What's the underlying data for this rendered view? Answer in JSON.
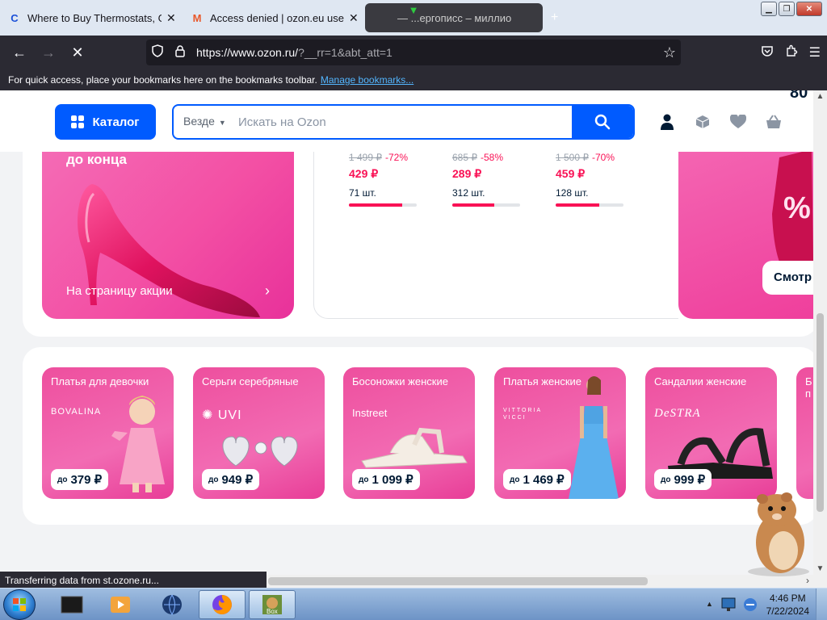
{
  "browser": {
    "tabs": [
      {
        "title": "Where to Buy Thermostats, Gas",
        "favicon": "C",
        "active": false
      },
      {
        "title": "Access denied | ozon.eu used C",
        "favicon": "M",
        "active": false
      },
      {
        "title": "— ...ергописс – миллио",
        "favicon": "",
        "active": true
      }
    ],
    "url_main": "https://www.ozon.ru/",
    "url_query": "?__rr=1&abt_att=1",
    "bookmark_hint": "For quick access, place your bookmarks here on the bookmarks toolbar.",
    "bookmark_link": "Manage bookmarks...",
    "status": "Transferring data from st.ozone.ru..."
  },
  "header": {
    "catalog_label": "Каталог",
    "search_scope": "Везде",
    "search_placeholder": "Искать на Ozon",
    "cut_text": "80"
  },
  "promo": {
    "title": "до конца",
    "link": "На страницу акции"
  },
  "deals": [
    {
      "old_price": "1 499 ₽",
      "discount": "-72%",
      "price": "429 ₽",
      "qty": "71 шт.",
      "sold_fraction": 0.78
    },
    {
      "old_price": "685 ₽",
      "discount": "-58%",
      "price": "289 ₽",
      "qty": "312 шт.",
      "sold_fraction": 0.62
    },
    {
      "old_price": "1 500 ₽",
      "discount": "-70%",
      "price": "459 ₽",
      "qty": "128 шт.",
      "sold_fraction": 0.64
    }
  ],
  "right_promo": {
    "button": "Смотр"
  },
  "categories": [
    {
      "title": "Платья для девочки",
      "brand": "BOVALINA",
      "price_prefix": "до",
      "price": "379 ₽"
    },
    {
      "title": "Серьги серебряные",
      "brand": "UVI",
      "price_prefix": "до",
      "price": "949 ₽"
    },
    {
      "title": "Босоножки женские",
      "brand": "Instreet",
      "price_prefix": "до",
      "price": "1 099 ₽"
    },
    {
      "title": "Платья женские",
      "brand": "VITTORIA VICCI",
      "price_prefix": "до",
      "price": "1 469 ₽"
    },
    {
      "title": "Сандалии женские",
      "brand": "DeSTRA",
      "price_prefix": "до",
      "price": "999 ₽"
    },
    {
      "title": "Б п",
      "brand": "",
      "price_prefix": "",
      "price": ""
    }
  ],
  "taskbar": {
    "time": "4:46 PM",
    "date": "7/22/2024"
  },
  "colors": {
    "brand_blue": "#005bff",
    "sale_red": "#f91155",
    "promo_pink": "#f34fa4"
  }
}
